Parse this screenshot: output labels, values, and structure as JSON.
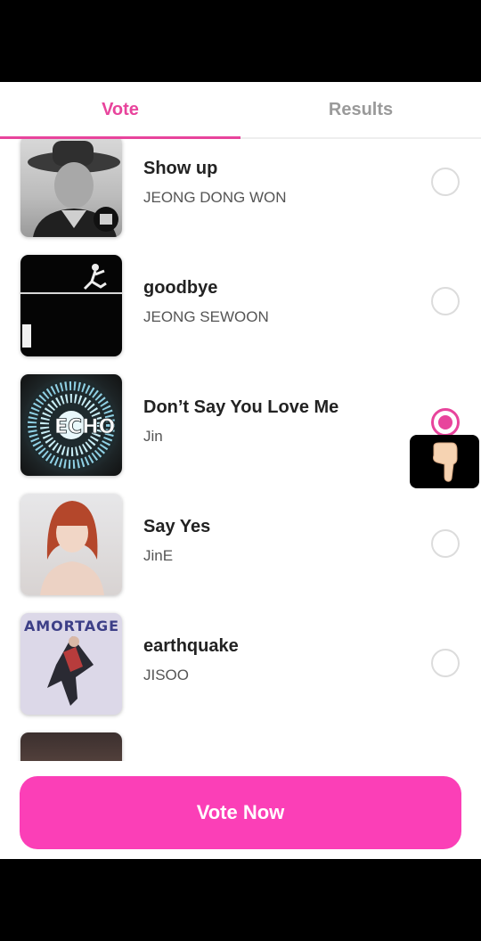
{
  "tabs": [
    {
      "label": "Vote",
      "active": true
    },
    {
      "label": "Results",
      "active": false
    }
  ],
  "songs": [
    {
      "title": "Show up",
      "artist": "JEONG DONG WON",
      "selected": false,
      "art_icon": "cowboy-portrait-art"
    },
    {
      "title": "goodbye",
      "artist": "JEONG SEWOON",
      "selected": false,
      "art_icon": "dancer-on-black-art"
    },
    {
      "title": "Don’t Say You Love Me",
      "artist": "Jin",
      "selected": true,
      "art_icon": "echo-record-art",
      "art_text": "ECHO"
    },
    {
      "title": "Say Yes",
      "artist": "JinE",
      "selected": false,
      "art_icon": "red-hair-portrait-art"
    },
    {
      "title": "earthquake",
      "artist": "JISOO",
      "selected": false,
      "art_icon": "amortage-cover-art",
      "art_text": "AMORTAGE"
    }
  ],
  "vote_button": {
    "label": "Vote Now"
  },
  "colors": {
    "accent": "#e8449c",
    "button": "#fb3fb7"
  },
  "pointer": {
    "icon": "pointing-hand-icon"
  }
}
